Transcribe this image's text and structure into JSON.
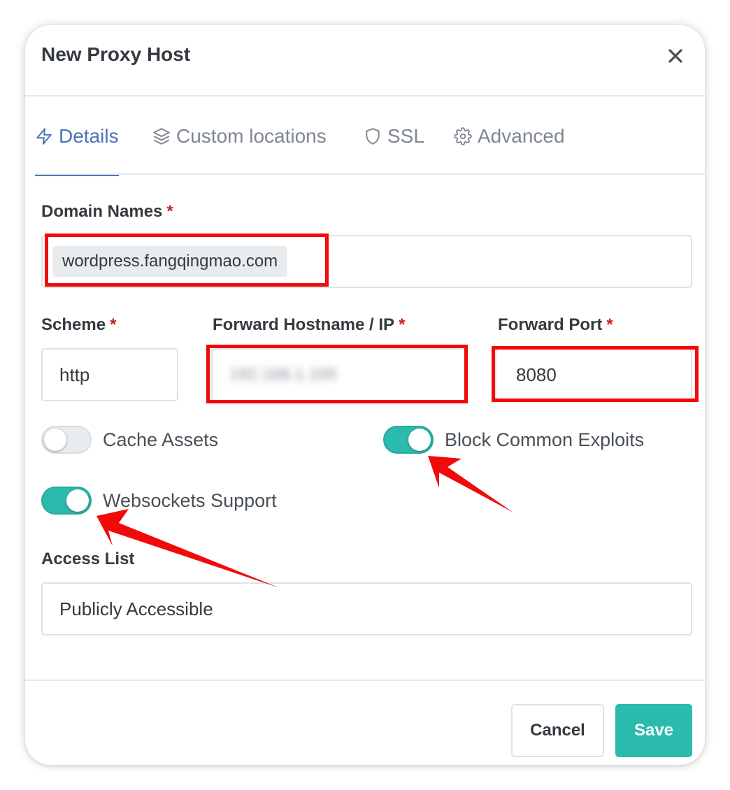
{
  "modal": {
    "title": "New Proxy Host"
  },
  "tabs": [
    {
      "label": "Details",
      "icon": "zap-icon",
      "active": true
    },
    {
      "label": "Custom locations",
      "icon": "layers-icon",
      "active": false
    },
    {
      "label": "SSL",
      "icon": "shield-icon",
      "active": false
    },
    {
      "label": "Advanced",
      "icon": "gear-icon",
      "active": false
    }
  ],
  "form": {
    "domain_names": {
      "label": "Domain Names",
      "required_mark": "*",
      "chips": [
        "wordpress.fangqingmao.com"
      ]
    },
    "scheme": {
      "label": "Scheme",
      "required_mark": "*",
      "value": "http"
    },
    "forward_host": {
      "label": "Forward Hostname / IP",
      "required_mark": "*",
      "value": "192.168.1.100"
    },
    "forward_port": {
      "label": "Forward Port",
      "required_mark": "*",
      "value": "8080"
    },
    "cache_assets": {
      "label": "Cache Assets",
      "enabled": false
    },
    "block_exploits": {
      "label": "Block Common Exploits",
      "enabled": true
    },
    "websockets": {
      "label": "Websockets Support",
      "enabled": true
    },
    "access_list": {
      "label": "Access List",
      "value": "Publicly Accessible"
    }
  },
  "footer": {
    "cancel_label": "Cancel",
    "save_label": "Save"
  },
  "colors": {
    "accent": "#4a73b5",
    "toggle_on": "#2bbbad",
    "annotation": "#f20a0a"
  }
}
